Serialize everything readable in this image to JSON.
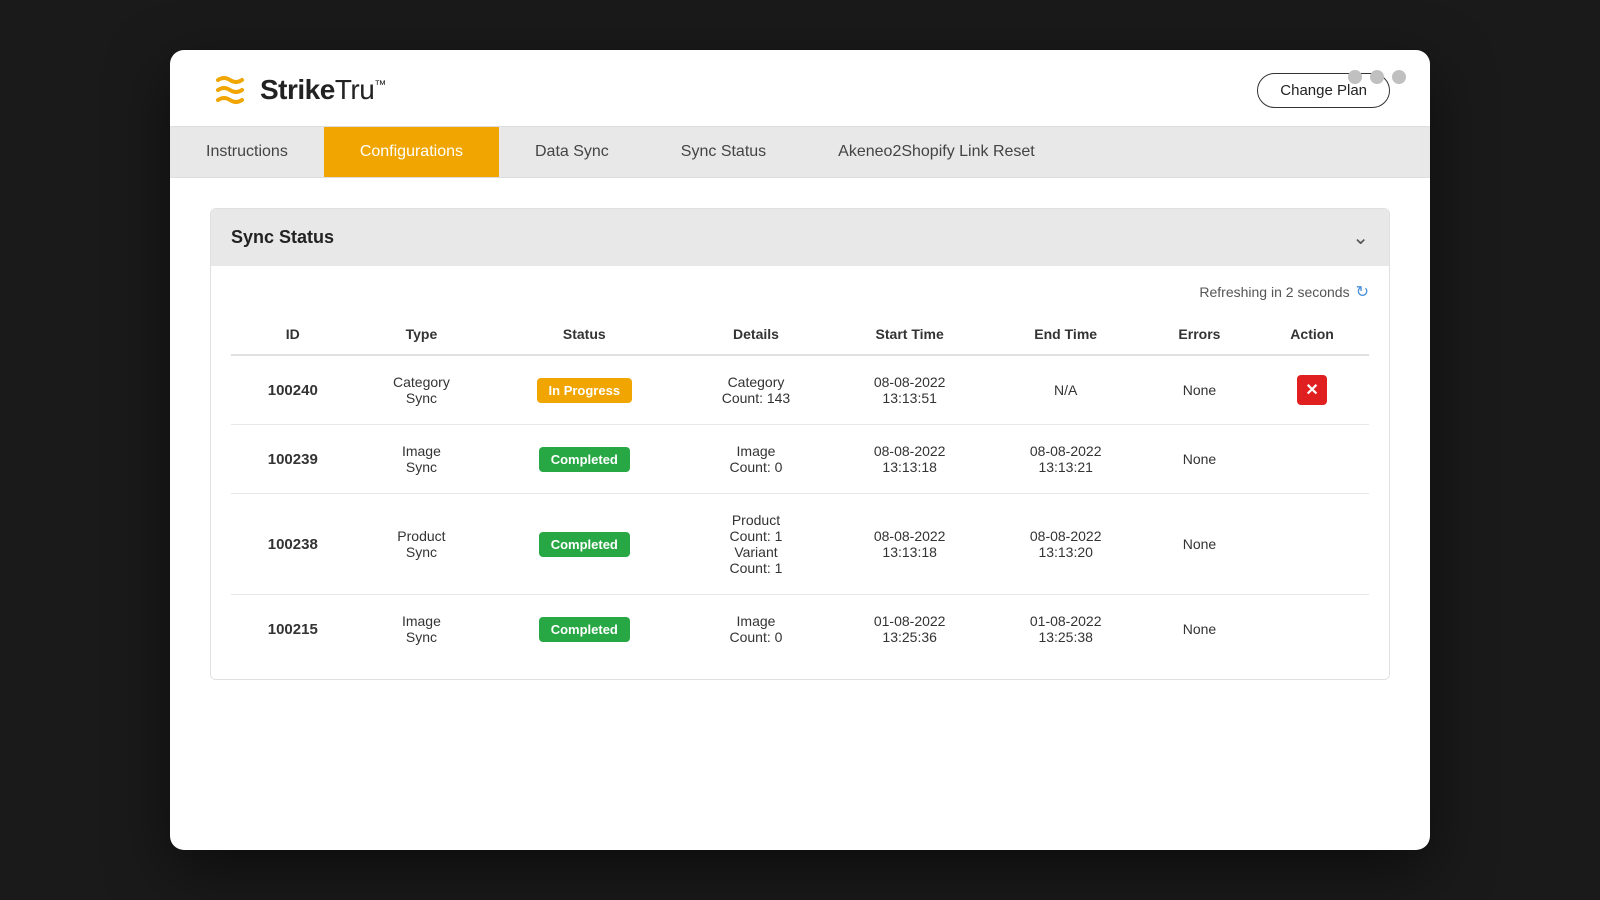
{
  "window": {
    "dots": [
      "dot1",
      "dot2",
      "dot3"
    ]
  },
  "logo": {
    "text": "StrikeTru",
    "tm": "™"
  },
  "header": {
    "change_plan_label": "Change Plan"
  },
  "nav": {
    "tabs": [
      {
        "label": "Instructions",
        "active": false
      },
      {
        "label": "Configurations",
        "active": true
      },
      {
        "label": "Data Sync",
        "active": false
      },
      {
        "label": "Sync Status",
        "active": false
      },
      {
        "label": "Akeneo2Shopify Link Reset",
        "active": false
      }
    ]
  },
  "sync_status": {
    "title": "Sync Status",
    "refresh_text": "Refreshing in 2 seconds",
    "columns": [
      "ID",
      "Type",
      "Status",
      "Details",
      "Start Time",
      "End Time",
      "Errors",
      "Action"
    ],
    "rows": [
      {
        "id": "100240",
        "type": "Category\nSync",
        "status": "In Progress",
        "status_type": "in-progress",
        "details": "Category\nCount: 143",
        "start_time": "08-08-2022\n13:13:51",
        "end_time": "N/A",
        "errors": "None",
        "has_cancel": true
      },
      {
        "id": "100239",
        "type": "Image\nSync",
        "status": "Completed",
        "status_type": "completed",
        "details": "Image\nCount: 0",
        "start_time": "08-08-2022\n13:13:18",
        "end_time": "08-08-2022\n13:13:21",
        "errors": "None",
        "has_cancel": false
      },
      {
        "id": "100238",
        "type": "Product\nSync",
        "status": "Completed",
        "status_type": "completed",
        "details": "Product\nCount: 1\nVariant\nCount: 1",
        "start_time": "08-08-2022\n13:13:18",
        "end_time": "08-08-2022\n13:13:20",
        "errors": "None",
        "has_cancel": false
      },
      {
        "id": "100215",
        "type": "Image\nSync",
        "status": "Completed",
        "status_type": "completed",
        "details": "Image\nCount: 0",
        "start_time": "01-08-2022\n13:25:36",
        "end_time": "01-08-2022\n13:25:38",
        "errors": "None",
        "has_cancel": false
      }
    ]
  }
}
